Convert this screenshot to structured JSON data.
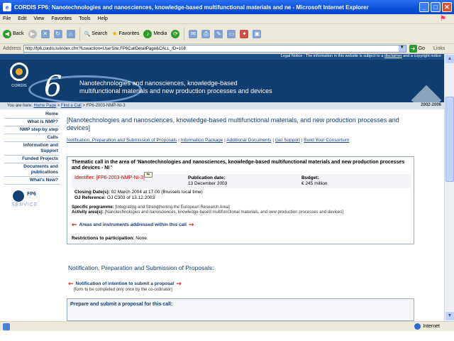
{
  "window": {
    "title": "CORDIS FP6: Nanotechnologies and nanosciences, knowledge-based multifunctional materials and ne - Microsoft Internet Explorer",
    "minimize": "_",
    "maximize": "□",
    "close": "✕"
  },
  "menu": [
    "File",
    "Edit",
    "View",
    "Favorites",
    "Tools",
    "Help"
  ],
  "toolbar": {
    "back": "Back",
    "search": "Search",
    "favorites": "Favorites",
    "media": "Media"
  },
  "address": {
    "label": "Address",
    "url": "http://fp6.cordis.lu/index.cfm?fuseaction=UserSite.FP6CallDetailPage&CALL_ID=108",
    "go": "Go",
    "links": "Links"
  },
  "banner": {
    "legal_prefix": "Legal Notice : The information in this website is subject to a",
    "legal_link": "disclaimer",
    "legal_suffix": "and a copyright notice",
    "cordis": "CORDIS",
    "six": "6",
    "headline_line1": "Nanotechnologies and nanosciences, knowledge-based",
    "headline_line2": "multifunctional materials and new production processes and devices"
  },
  "breadcrumb": {
    "prefix": "You are here:",
    "home": "Home Page",
    "sep1": ">",
    "find": "Find a Call",
    "sep2": ">",
    "current": "FP6-2003-NMP-NI-3",
    "years": "2002-2006"
  },
  "nav": [
    "Home",
    "What is NMP?",
    "NMP step by step",
    "Calls",
    "Information and Support",
    "Funded Projects",
    "Documents and publications",
    "What's New?"
  ],
  "fp6_service": {
    "fp": "FP6",
    "svc": "SERVICE"
  },
  "main": {
    "title": "[Nanotechnologies and nanosciences, knowledge-based multifunctional materials, and new production processes and devices]",
    "links": [
      "Notification, Preparation and Submission of Proposals",
      "Information Package",
      "Additional Documents",
      "Get Support",
      "Build Your Consortium"
    ],
    "link_sep": "|"
  },
  "call": {
    "thematic": "Thematic call in the area of 'Nanotechnologies and nanosciences, knowledge-based multifunctional materials and new production processes and devices - NI '",
    "identifier": "Identifier: [FP6-2003-NMP-NI-3]",
    "pub_label": "Publication date:",
    "pub_value": "13 December 2003",
    "budget_label": "Budget:",
    "budget_value": "€ 245 million",
    "closing_label": "Closing Date(s):",
    "closing_value": "02 March 2004 at 17.00 (Brussels local time)",
    "oj_label": "OJ Reference:",
    "oj_value": "OJ C303 of 13.12.2003",
    "programme_label": "Specific programme:",
    "programme_value": "[Integrating and Strengthening the European Research Area]",
    "activity_label": "Activity area(s):",
    "activity_value": "[Nanotechnologies and nanosciences, knowledge-based multifunctional materials, and new production processes and devices]",
    "areas_button": "Areas and instruments addressed within this call",
    "restrictions_label": "Restrictions to participation:",
    "restrictions_value": "None."
  },
  "tooltip_marker": "⇆",
  "notification": {
    "heading": "Notification, Preparation and Submission of Proposals:",
    "intent_title": "Notification of intention to submit a proposal",
    "intent_sub": "[form to be completed only once by the co-ordinator]",
    "prepare": "Prepare and submit a proposal for this call:"
  },
  "status": {
    "zone": "Internet"
  },
  "colors": {
    "titlebar": "#0a4fd8",
    "banner": "#0e3d6e",
    "nav_text": "#143c6e",
    "identifier": "#cc0000"
  }
}
